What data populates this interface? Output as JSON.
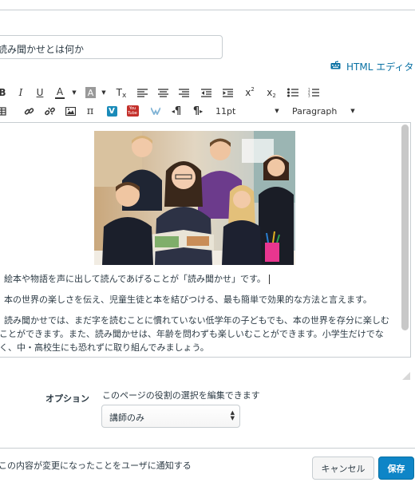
{
  "title_field": {
    "value": "読み聞かせとは何か"
  },
  "html_editor": {
    "label": "HTML エディタ",
    "icon": "keyboard-icon"
  },
  "toolbar": {
    "row1": {
      "bold": "B",
      "italic": "I",
      "underline": "U",
      "font_color": "A",
      "background_color": "A",
      "clear_format": "T",
      "superscript": "x",
      "superscript_mark": "2",
      "subscript": "x",
      "subscript_mark": "2"
    },
    "row2": {
      "math": "π",
      "youtube": "You\nTube",
      "ltr": "¶",
      "rtl": "¶",
      "font_size": "11pt",
      "block_format": "Paragraph"
    }
  },
  "content": {
    "paragraphs": [
      "絵本や物語を声に出して読んであげることが「読み聞かせ」です。",
      "本の世界の楽しさを伝え、児童生徒と本を結びつける、最も簡単で効果的な方法と言えます。",
      "読み聞かせでは、まだ字を読むことに慣れていない低学年の子どもでも、本の世界を存分に楽しむ",
      "ことができます。また、読み聞かせは、年齢を問わずも楽しいむことができます。小学生だけでな",
      "く、中・高校生にも恐れずに取り組んでみましょう。"
    ]
  },
  "options": {
    "label": "オプション",
    "description": "このページの役割の選択を編集できます",
    "selected": "講師のみ"
  },
  "notify": {
    "label": "この内容が変更になったことをユーザに通知する"
  },
  "buttons": {
    "cancel": "キャンセル",
    "save": "保存"
  },
  "colors": {
    "accent": "#0e85c7",
    "link": "#0770a3",
    "border": "#c7cdd1",
    "text": "#2d3b45"
  }
}
